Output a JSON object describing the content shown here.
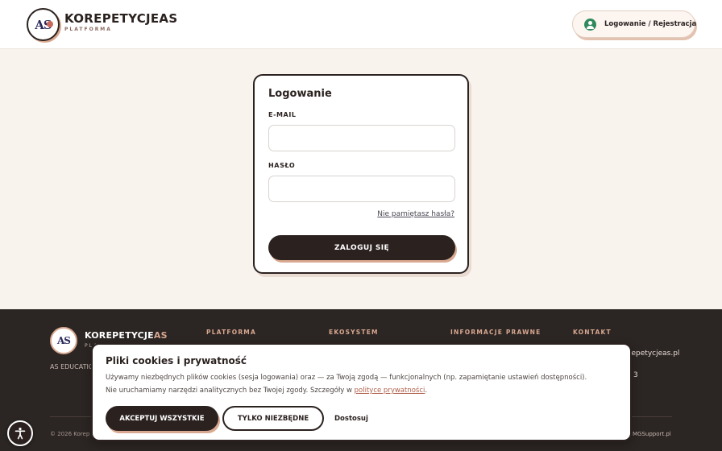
{
  "header": {
    "logo_text": "AS",
    "brand": "KOREPETYCJEAS",
    "brand_sub": "PLATFORMA",
    "login_button": "Logowanie / Rejestracja"
  },
  "login": {
    "title": "Logowanie",
    "email_label": "E-MAIL",
    "email_value": "",
    "password_label": "HASŁO",
    "password_value": "",
    "forgot_link": "Nie pamiętasz hasła?",
    "submit": "ZALOGUJ SIĘ"
  },
  "footer": {
    "logo_text": "AS",
    "brand_main": "KOREPETYCJE",
    "brand_accent": "AS",
    "brand_sub": "PLATFORMA",
    "tagline": "AS EDUCATIO",
    "columns": [
      "PLATFORMA",
      "EKOSYSTEM",
      "INFORMACJE PRAWNE",
      "KONTAKT"
    ],
    "email_fragment": "repetycjeas.pl",
    "phone_fragment": "3",
    "copyright_fragment": "© 2026 Korep",
    "support_fragment": "MGSupport.pl"
  },
  "cookie": {
    "title": "Pliki cookies i prywatność",
    "line1": "Używamy niezbędnych plików cookies (sesja logowania) oraz — za Twoją zgodą — funkcjonalnych (np. zapamiętanie ustawień dostępności).",
    "line2_before": "Nie uruchamiamy narzędzi analitycznych bez Twojej zgody. Szczegóły w ",
    "line2_link": "polityce prywatności",
    "line2_after": ".",
    "accept_all": "AKCEPTUJ WSZYSTKIE",
    "essential_only": "TYLKO NIEZBĘDNE",
    "customize": "Dostosuj"
  },
  "colors": {
    "accent": "#d8a890",
    "dark": "#2b2220",
    "page_bg": "#f9f3ee",
    "footer_bg": "#2b2523",
    "link": "#b0604a",
    "user_icon": "#2f8a5c"
  },
  "icons": {
    "user": "user-circle-icon",
    "accessibility": "accessibility-icon"
  }
}
